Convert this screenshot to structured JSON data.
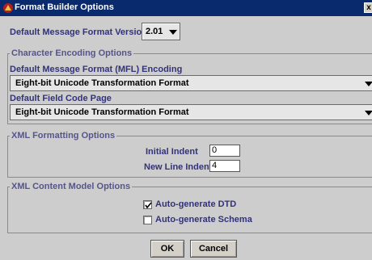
{
  "window": {
    "title": "Format Builder Options",
    "close_label": "x"
  },
  "version": {
    "label": "Default Message Format Version",
    "value": "2.01"
  },
  "encoding": {
    "group_title": "Character Encoding Options",
    "mfl_label": "Default Message Format (MFL) Encoding",
    "mfl_value": "Eight-bit Unicode Transformation Format",
    "field_label": "Default Field Code Page",
    "field_value": "Eight-bit Unicode Transformation Format"
  },
  "xml_formatting": {
    "group_title": "XML Formatting Options",
    "initial_indent_label": "Initial Indent",
    "initial_indent_value": "0",
    "new_line_indent_label": "New Line Indent",
    "new_line_indent_value": "4"
  },
  "xml_content": {
    "group_title": "XML Content Model Options",
    "dtd_label": "Auto-generate DTD",
    "dtd_checked": true,
    "schema_label": "Auto-generate Schema",
    "schema_checked": false
  },
  "buttons": {
    "ok": "OK",
    "cancel": "Cancel"
  }
}
